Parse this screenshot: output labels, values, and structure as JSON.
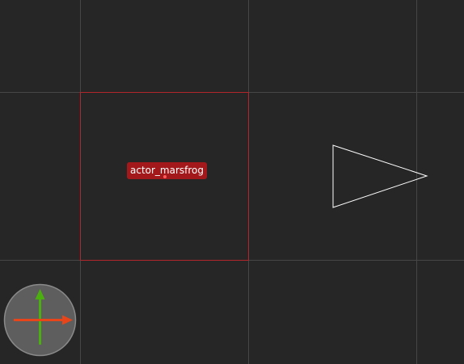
{
  "viewport": {
    "background_color": "#262626",
    "grid_color": "#464646"
  },
  "actor": {
    "label": "actor_marsfrog",
    "label_bg_color": "#a3191b",
    "selection_color": "#b0262a"
  },
  "camera": {
    "icon": "triangle-outline-icon",
    "stroke_color": "#ffffff"
  },
  "axis_gizmo": {
    "icon": "axis-gizmo-icon",
    "y_axis_color": "#4caf10",
    "x_axis_color": "#e8461a",
    "background_color": "#5e5e5e"
  }
}
